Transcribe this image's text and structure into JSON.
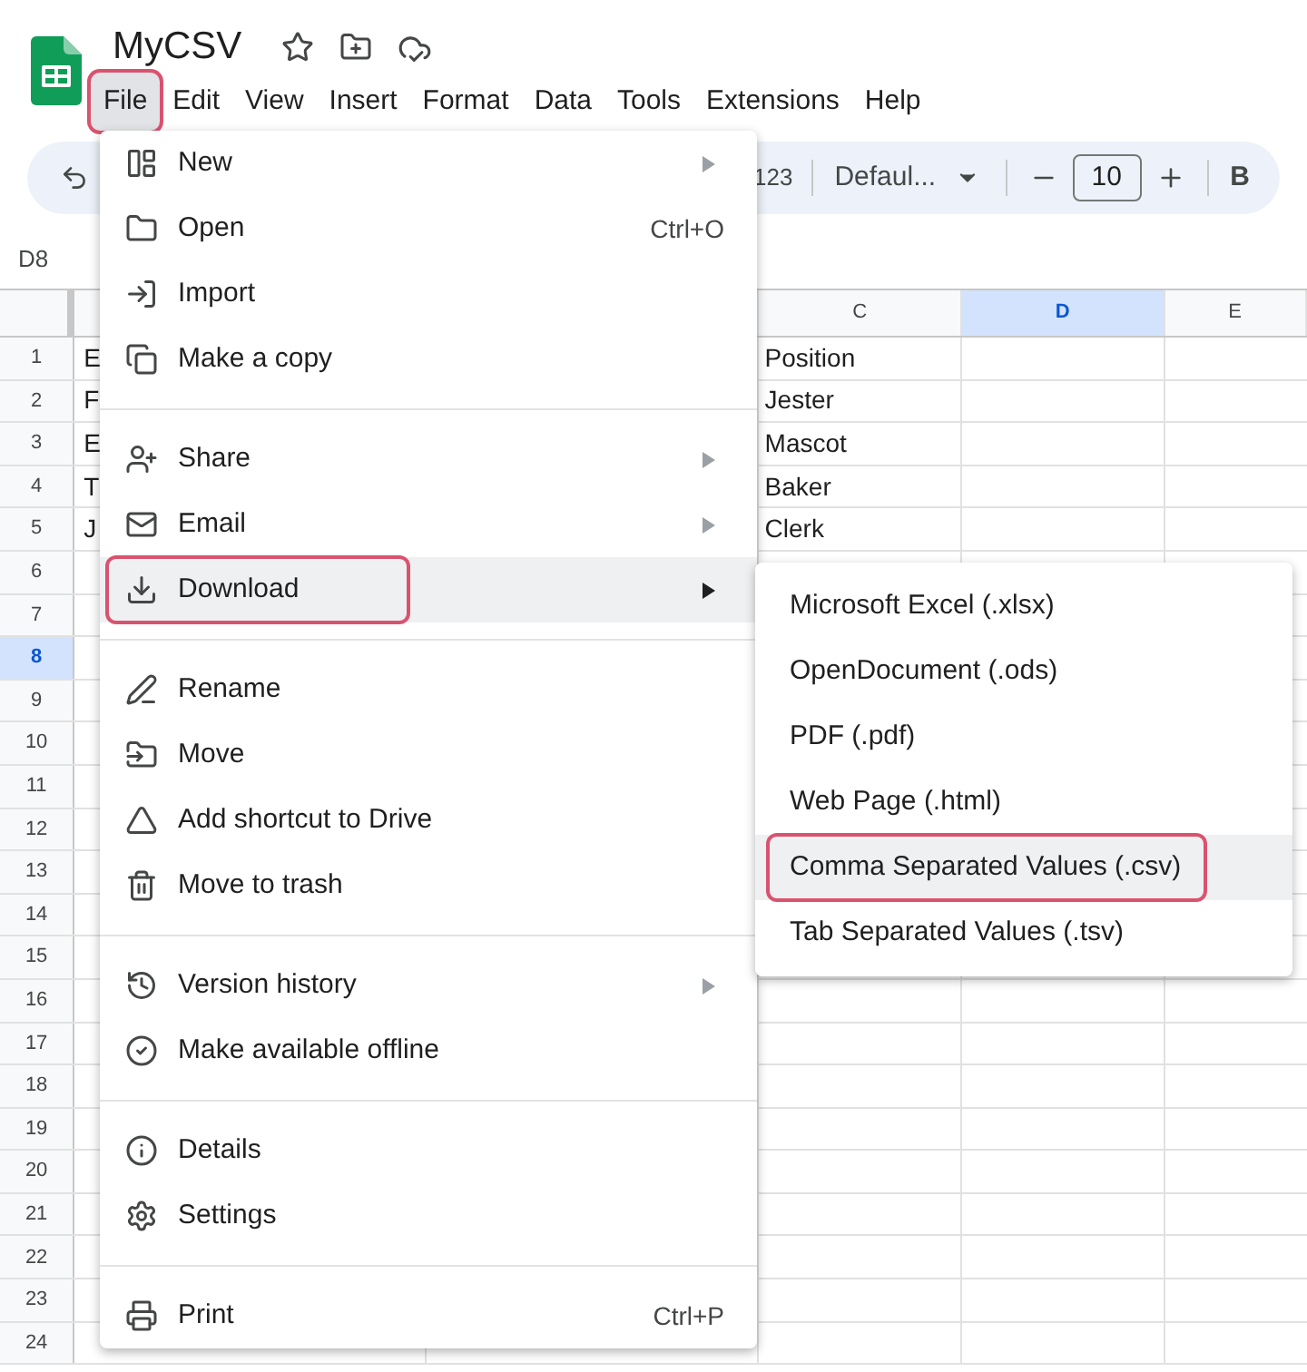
{
  "document": {
    "title": "MyCSV"
  },
  "menu_bar": [
    {
      "label": "File",
      "selected": true,
      "annotated": true
    },
    {
      "label": "Edit",
      "selected": false,
      "annotated": false
    },
    {
      "label": "View",
      "selected": false,
      "annotated": false
    },
    {
      "label": "Insert",
      "selected": false,
      "annotated": false
    },
    {
      "label": "Format",
      "selected": false,
      "annotated": false
    },
    {
      "label": "Data",
      "selected": false,
      "annotated": false
    },
    {
      "label": "Tools",
      "selected": false,
      "annotated": false
    },
    {
      "label": "Extensions",
      "selected": false,
      "annotated": false
    },
    {
      "label": "Help",
      "selected": false,
      "annotated": false
    }
  ],
  "toolbar": {
    "number_format": "123",
    "font": "Defaul...",
    "font_size": "10",
    "bold": "B"
  },
  "name_box": "D8",
  "columns": [
    {
      "label": "C",
      "selected": false
    },
    {
      "label": "D",
      "selected": true
    },
    {
      "label": "E",
      "selected": false
    }
  ],
  "rows": [
    {
      "label": "1",
      "selected": false,
      "cells": [
        "E",
        "Position"
      ]
    },
    {
      "label": "2",
      "selected": false,
      "cells": [
        "F",
        "Jester"
      ]
    },
    {
      "label": "3",
      "selected": false,
      "cells": [
        "E",
        "Mascot"
      ]
    },
    {
      "label": "4",
      "selected": false,
      "cells": [
        "T",
        "Baker"
      ]
    },
    {
      "label": "5",
      "selected": false,
      "cells": [
        "J",
        "Clerk"
      ]
    },
    {
      "label": "6",
      "selected": false,
      "cells": []
    },
    {
      "label": "7",
      "selected": false,
      "cells": []
    },
    {
      "label": "8",
      "selected": true,
      "cells": []
    },
    {
      "label": "9",
      "selected": false,
      "cells": []
    },
    {
      "label": "10",
      "selected": false,
      "cells": []
    },
    {
      "label": "11",
      "selected": false,
      "cells": []
    },
    {
      "label": "12",
      "selected": false,
      "cells": []
    },
    {
      "label": "13",
      "selected": false,
      "cells": []
    },
    {
      "label": "14",
      "selected": false,
      "cells": []
    },
    {
      "label": "15",
      "selected": false,
      "cells": []
    },
    {
      "label": "16",
      "selected": false,
      "cells": []
    },
    {
      "label": "17",
      "selected": false,
      "cells": []
    },
    {
      "label": "18",
      "selected": false,
      "cells": []
    },
    {
      "label": "19",
      "selected": false,
      "cells": []
    },
    {
      "label": "20",
      "selected": false,
      "cells": []
    },
    {
      "label": "21",
      "selected": false,
      "cells": []
    },
    {
      "label": "22",
      "selected": false,
      "cells": []
    },
    {
      "label": "23",
      "selected": false,
      "cells": []
    },
    {
      "label": "24",
      "selected": false,
      "cells": []
    }
  ],
  "file_menu": {
    "sections": [
      [
        {
          "label": "New",
          "has_submenu": true,
          "selected": false,
          "annotated": false
        },
        {
          "label": "Open",
          "shortcut": "Ctrl+O",
          "has_submenu": false,
          "selected": false,
          "annotated": false
        },
        {
          "label": "Import",
          "has_submenu": false,
          "selected": false,
          "annotated": false
        },
        {
          "label": "Make a copy",
          "has_submenu": false,
          "selected": false,
          "annotated": false
        }
      ],
      [
        {
          "label": "Share",
          "has_submenu": true,
          "selected": false,
          "annotated": false
        },
        {
          "label": "Email",
          "has_submenu": true,
          "selected": false,
          "annotated": false
        },
        {
          "label": "Download",
          "has_submenu": true,
          "selected": true,
          "annotated": true
        }
      ],
      [
        {
          "label": "Rename",
          "has_submenu": false,
          "selected": false,
          "annotated": false
        },
        {
          "label": "Move",
          "has_submenu": false,
          "selected": false,
          "annotated": false
        },
        {
          "label": "Add shortcut to Drive",
          "has_submenu": false,
          "selected": false,
          "annotated": false
        },
        {
          "label": "Move to trash",
          "has_submenu": false,
          "selected": false,
          "annotated": false
        }
      ],
      [
        {
          "label": "Version history",
          "has_submenu": true,
          "selected": false,
          "annotated": false
        },
        {
          "label": "Make available offline",
          "has_submenu": false,
          "selected": false,
          "annotated": false
        }
      ],
      [
        {
          "label": "Details",
          "has_submenu": false,
          "selected": false,
          "annotated": false
        },
        {
          "label": "Settings",
          "has_submenu": false,
          "selected": false,
          "annotated": false
        }
      ],
      [
        {
          "label": "Print",
          "shortcut": "Ctrl+P",
          "has_submenu": false,
          "selected": false,
          "annotated": false
        }
      ]
    ]
  },
  "download_submenu": [
    {
      "label": "Microsoft Excel (.xlsx)",
      "annotated": false
    },
    {
      "label": "OpenDocument (.ods)",
      "annotated": false
    },
    {
      "label": "PDF (.pdf)",
      "annotated": false
    },
    {
      "label": "Web Page (.html)",
      "annotated": false
    },
    {
      "label": "Comma Separated Values (.csv)",
      "annotated": true
    },
    {
      "label": "Tab Separated Values (.tsv)",
      "annotated": false
    }
  ]
}
